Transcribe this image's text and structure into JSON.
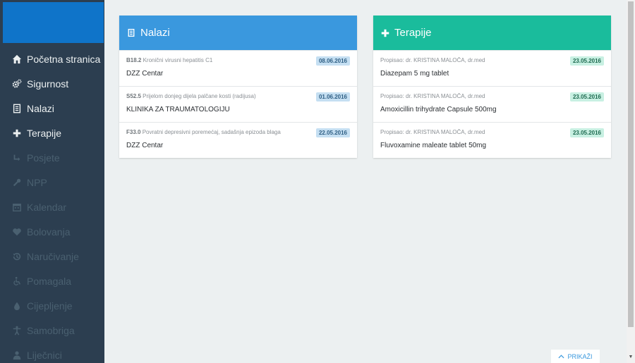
{
  "sidebar": {
    "items": [
      {
        "label": "Početna stranica",
        "icon": "home-icon",
        "enabled": true
      },
      {
        "label": "Sigurnost",
        "icon": "gears-icon",
        "enabled": true
      },
      {
        "label": "Nalazi",
        "icon": "document-icon",
        "enabled": true
      },
      {
        "label": "Terapije",
        "icon": "plus-icon",
        "enabled": true
      },
      {
        "label": "Posjete",
        "icon": "reply-arrow-icon",
        "enabled": false
      },
      {
        "label": "NPP",
        "icon": "wrench-icon",
        "enabled": false
      },
      {
        "label": "Kalendar",
        "icon": "calendar-icon",
        "enabled": false
      },
      {
        "label": "Bolovanja",
        "icon": "heart-icon",
        "enabled": false
      },
      {
        "label": "Naručivanje",
        "icon": "history-icon",
        "enabled": false
      },
      {
        "label": "Pomagala",
        "icon": "wheelchair-icon",
        "enabled": false
      },
      {
        "label": "Cijepljenje",
        "icon": "drop-icon",
        "enabled": false
      },
      {
        "label": "Samobriga",
        "icon": "person-icon",
        "enabled": false
      },
      {
        "label": "Liječnici",
        "icon": "doctor-icon",
        "enabled": false
      }
    ]
  },
  "nalazi": {
    "title": "Nalazi",
    "rows": [
      {
        "code": "B18.2",
        "desc": "Kronični virusni hepatitis C1",
        "date": "08.06.2016",
        "main": "DZZ Centar"
      },
      {
        "code": "S52.5",
        "desc": "Prijelom donjeg dijela palčane kosti (radijusa)",
        "date": "01.06.2016",
        "main": "KLINIKA ZA TRAUMATOLOGIJU"
      },
      {
        "code": "F33.0",
        "desc": "Povratni depresivni poremećaj, sadašnja epizoda blaga",
        "date": "22.05.2016",
        "main": "DZZ Centar"
      }
    ]
  },
  "terapije": {
    "title": "Terapije",
    "rows": [
      {
        "sub": "Propisao: dr. KRISTINA MALOČA, dr.med",
        "date": "23.05.2016",
        "main": "Diazepam 5 mg tablet"
      },
      {
        "sub": "Propisao: dr. KRISTINA MALOČA, dr.med",
        "date": "23.05.2016",
        "main": "Amoxicillin trihydrate Capsule 500mg"
      },
      {
        "sub": "Propisao: dr. KRISTINA MALOČA, dr.med",
        "date": "23.05.2016",
        "main": "Fluvoxamine maleate tablet 50mg"
      }
    ]
  },
  "prikazi_label": "PRIKAŽI",
  "colors": {
    "sidebar_bg": "#2c3e50",
    "brand_bg": "#0f74c9",
    "nalazi_header": "#3a98de",
    "terapije_header": "#1abc9c"
  }
}
